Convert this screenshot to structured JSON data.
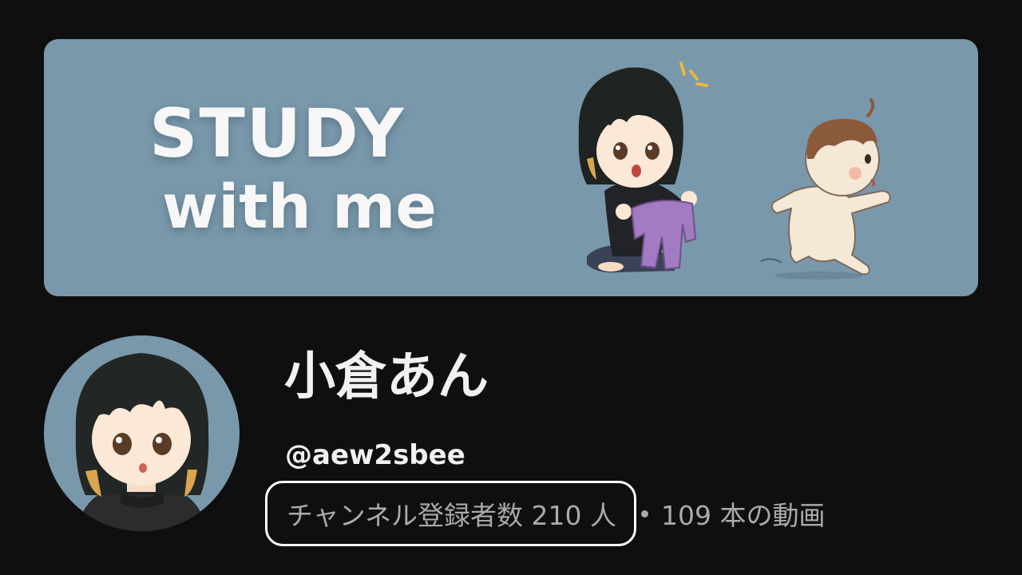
{
  "banner": {
    "title_line1": "STUDY",
    "title_line2": "with me",
    "background": "#7a98ab"
  },
  "channel": {
    "name": "小倉あん",
    "handle": "@aew2sbee",
    "subscribers": "チャンネル登録者数 210 人",
    "videos": "109 本の動画"
  },
  "icons": {
    "avatar": "avatar-illustration",
    "separator": "dot-separator-icon"
  },
  "colors": {
    "page_background": "#0f0f0f",
    "primary_text": "#f1f1f1",
    "secondary_text": "#aaaaaa",
    "highlight_border": "#ffffff"
  }
}
